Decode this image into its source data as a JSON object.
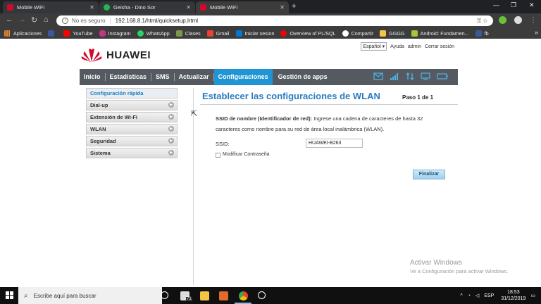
{
  "browser": {
    "tabs": [
      {
        "title": "Mobile WiFi",
        "active": false
      },
      {
        "title": "Geisha - Dino Sor",
        "active": false
      },
      {
        "title": "Mobile WiFi",
        "active": true
      }
    ],
    "address": {
      "security": "No es seguro",
      "url": "192.168.8.1/html/quicksetup.html"
    },
    "bookmarks": [
      "Aplicaciones",
      "",
      "YouTube",
      "Instagram",
      "WhatsApp",
      "Clases",
      "Gmail",
      "Iniciar sesion",
      "Overview of PL/SQL",
      "Compartir",
      "GGGG",
      "Android: Fundamen...",
      "fb"
    ]
  },
  "header": {
    "brand": "HUAWEI",
    "language": "Español ▾",
    "user": "Ayuda",
    "admin": "admin",
    "logout": "Cerrar sesión"
  },
  "menu": [
    {
      "label": "Inicio",
      "active": false
    },
    {
      "label": "Estadísticas",
      "active": false
    },
    {
      "label": "SMS",
      "active": false
    },
    {
      "label": "Actualizar",
      "active": false
    },
    {
      "label": "Configuraciones",
      "active": true
    },
    {
      "label": "Gestión de apps",
      "active": false
    }
  ],
  "sidebar": [
    {
      "label": "Configuración rápida",
      "active": true
    },
    {
      "label": "Dial-up",
      "active": false
    },
    {
      "label": "Extensión de Wi-Fi",
      "active": false
    },
    {
      "label": "WLAN",
      "active": false
    },
    {
      "label": "Seguridad",
      "active": false
    },
    {
      "label": "Sistema",
      "active": false
    }
  ],
  "content": {
    "title": "Establecer las configuraciones de WLAN",
    "step": "Paso 1 de 1",
    "desc_bold": "SSID de nombre (Identificador de red):",
    "desc_rest": " Ingrese una cadena de caracteres de hasta 32 caracteres como nombre para su red de área local inalámbrica (WLAN).",
    "ssid_label": "SSID:",
    "ssid_value": "HUAWEI-B263",
    "modify_password": "Modificar Contraseña",
    "finish": "Finalizar"
  },
  "watermark": {
    "line1": "Activar Windows",
    "line2": "Ve a Configuración para activar Windows."
  },
  "taskbar": {
    "search_placeholder": "Escribe aquí para buscar",
    "badge": "71",
    "lang": "ESP",
    "time": "18:53",
    "date": "31/12/2019"
  },
  "colors": {
    "accent": "#1f95d4",
    "menubar": "#545a60",
    "title": "#2a7bbf",
    "brand_red": "#cf0a2c"
  }
}
